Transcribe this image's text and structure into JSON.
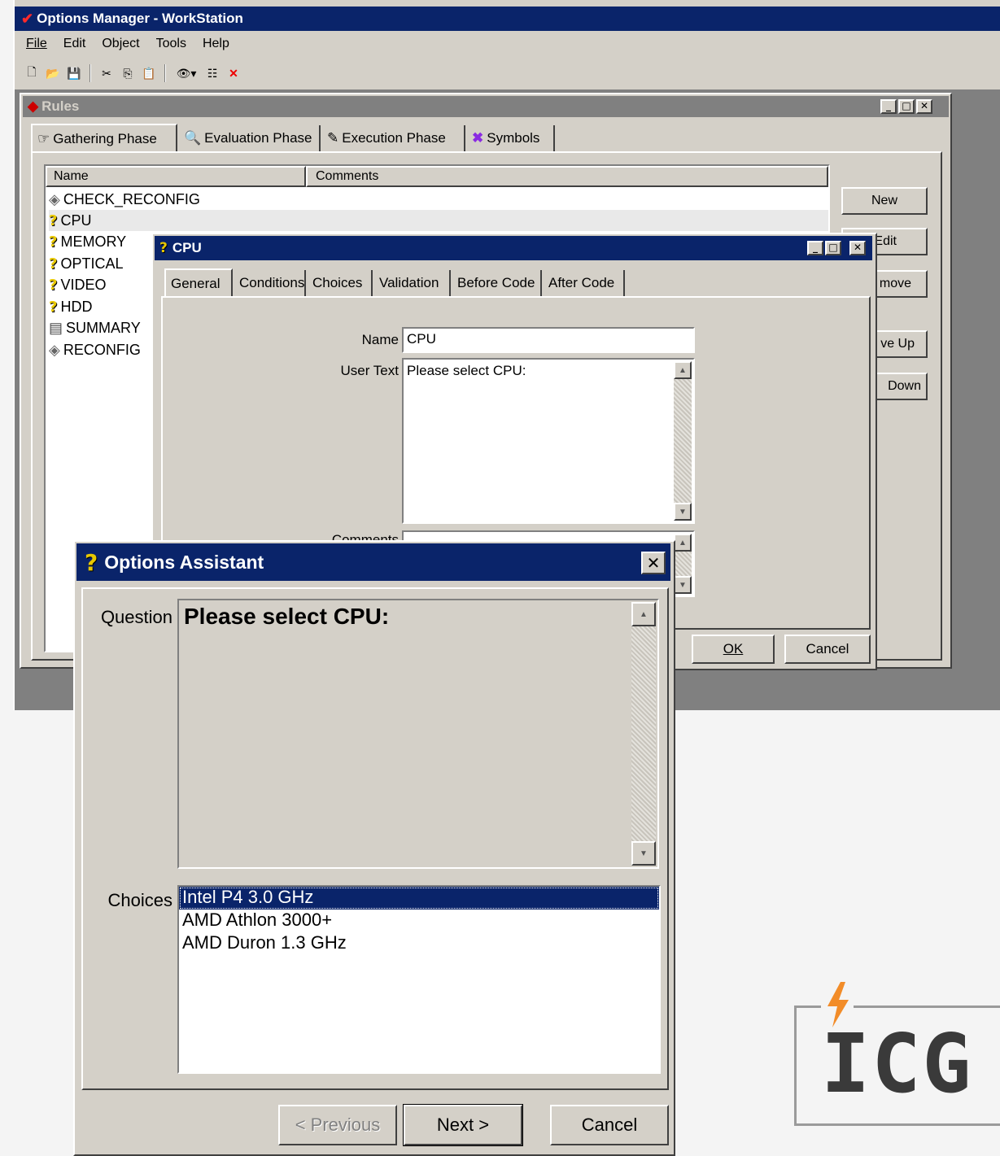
{
  "app": {
    "title": "Options Manager - WorkStation",
    "menu": [
      "File",
      "Edit",
      "Object",
      "Tools",
      "Help"
    ]
  },
  "toolbar": {
    "icons": [
      "new-file-icon",
      "open-folder-icon",
      "save-disk-icon",
      "cut-icon",
      "copy-icon",
      "paste-icon",
      "eye-icon",
      "properties-icon",
      "delete-icon"
    ]
  },
  "rules": {
    "title": "Rules",
    "tabs": [
      "Gathering Phase",
      "Evaluation Phase",
      "Execution Phase",
      "Symbols"
    ],
    "columns": [
      "Name",
      "Comments"
    ],
    "items": [
      {
        "name": "CHECK_RECONFIG",
        "icon": "eye-icon"
      },
      {
        "name": "CPU",
        "icon": "question-icon"
      },
      {
        "name": "MEMORY",
        "icon": "question-icon"
      },
      {
        "name": "OPTICAL",
        "icon": "question-icon"
      },
      {
        "name": "VIDEO",
        "icon": "question-icon"
      },
      {
        "name": "HDD",
        "icon": "question-icon"
      },
      {
        "name": "SUMMARY",
        "icon": "document-icon"
      },
      {
        "name": "RECONFIG",
        "icon": "eye-icon"
      }
    ],
    "buttons": [
      "New",
      "Edit",
      "move",
      "ve Up",
      "Down"
    ]
  },
  "cpu_dialog": {
    "title": "CPU",
    "tabs": [
      "General",
      "Conditions",
      "Choices",
      "Validation",
      "Before Code",
      "After Code"
    ],
    "name_label": "Name",
    "name_value": "CPU",
    "user_text_label": "User Text",
    "user_text_value": "Please select CPU:",
    "comments_label": "Comments",
    "ok": "OK",
    "cancel": "Cancel"
  },
  "assistant": {
    "title": "Options Assistant",
    "question_label": "Question",
    "question_text": "Please select CPU:",
    "choices_label": "Choices",
    "choices": [
      "Intel P4 3.0 GHz",
      "AMD Athlon 3000+",
      "AMD Duron 1.3 GHz"
    ],
    "selected_index": 0,
    "previous": "< Previous",
    "next": "Next >",
    "cancel": "Cancel"
  },
  "logo": {
    "text": "ICG",
    "accent": "#f28c28"
  }
}
